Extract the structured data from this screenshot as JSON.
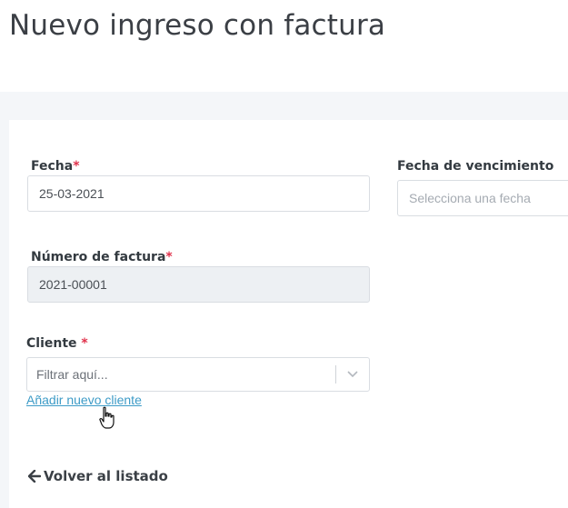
{
  "page": {
    "title": "Nuevo ingreso con factura"
  },
  "form": {
    "required_mark": "*",
    "fecha": {
      "label": "Fecha",
      "value": "25-03-2021"
    },
    "fecha_vencimiento": {
      "label": "Fecha de vencimiento",
      "placeholder": "Selecciona una fecha"
    },
    "numero_factura": {
      "label": "Número de factura",
      "value": "2021-00001"
    },
    "cliente": {
      "label": "Cliente",
      "placeholder": "Filtrar aquí...",
      "add_link": "Añadir nuevo cliente"
    }
  },
  "footer": {
    "back_label": "Volver al listado"
  },
  "icons": {
    "dropdown": "chevron-down-icon",
    "back": "arrow-left-icon",
    "pointer": "hand-pointer-icon"
  },
  "colors": {
    "required": "#e0314b",
    "link": "#3d9bc7",
    "band": "#f4f6f9",
    "readonly_field": "#edf0f3"
  }
}
